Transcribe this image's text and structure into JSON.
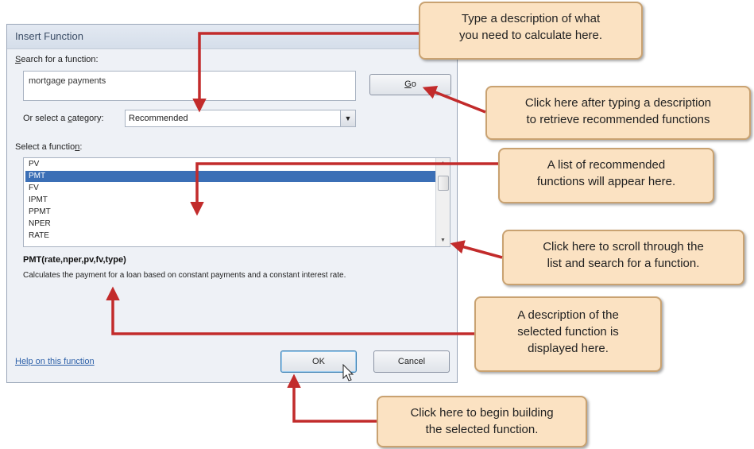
{
  "dialog": {
    "title": "Insert Function",
    "help_glyph": "?",
    "search_label_prefix": "S",
    "search_label_rest": "earch for a function:",
    "search_value": "mortgage payments",
    "go_label_prefix": "G",
    "go_label_rest": "o",
    "category_label_a": "Or select a ",
    "category_label_u": "c",
    "category_label_b": "ategory:",
    "category_value": "Recommended",
    "select_label_a": "Select a functio",
    "select_label_u": "n",
    "select_label_b": ":",
    "functions": [
      "PV",
      "PMT",
      "FV",
      "IPMT",
      "PPMT",
      "NPER",
      "RATE"
    ],
    "selected_function": "PMT",
    "signature": "PMT(rate,nper,pv,fv,type)",
    "description": "Calculates the payment for a loan based on constant payments and a constant interest rate.",
    "help_link": "Help on this function",
    "ok_label": "OK",
    "cancel_label": "Cancel"
  },
  "callouts": {
    "search": [
      "Type a description of what",
      "you need to calculate here."
    ],
    "go": [
      "Click here after typing a description",
      "to retrieve recommended functions"
    ],
    "list": [
      "A list of recommended",
      "functions will appear here."
    ],
    "scroll": [
      "Click here to scroll through the",
      "list and search for a function."
    ],
    "description": [
      "A description of the",
      "selected function is",
      "displayed here."
    ],
    "ok": [
      "Click here to begin building",
      "the selected function."
    ]
  },
  "colors": {
    "arrow": "#c22b2b",
    "callout_fill": "#fbe2c2",
    "callout_border": "#c9a271",
    "selection": "#3b6fb6"
  }
}
